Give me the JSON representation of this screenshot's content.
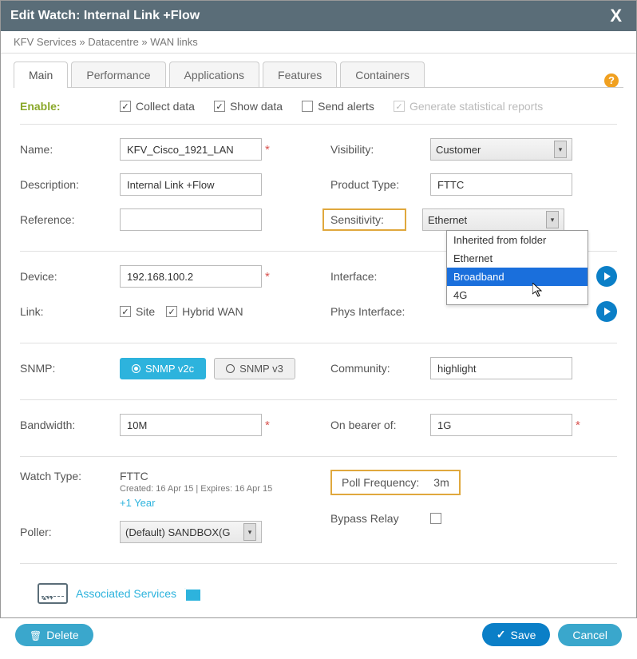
{
  "header": {
    "title": "Edit Watch: Internal Link +Flow"
  },
  "breadcrumb": [
    "KFV Services",
    "Datacentre",
    "WAN links"
  ],
  "tabs": [
    "Main",
    "Performance",
    "Applications",
    "Features",
    "Containers"
  ],
  "active_tab": "Main",
  "enable": {
    "label": "Enable:",
    "collect": {
      "label": "Collect data",
      "checked": true
    },
    "show": {
      "label": "Show data",
      "checked": true
    },
    "send": {
      "label": "Send alerts",
      "checked": false
    },
    "reports": {
      "label": "Generate statistical reports",
      "checked": true,
      "disabled": true
    }
  },
  "left1": {
    "name": {
      "label": "Name:",
      "value": "KFV_Cisco_1921_LAN",
      "required": true
    },
    "description": {
      "label": "Description:",
      "value": "Internal Link +Flow"
    },
    "reference": {
      "label": "Reference:",
      "value": ""
    }
  },
  "right1": {
    "visibility": {
      "label": "Visibility:",
      "value": "Customer"
    },
    "product_type": {
      "label": "Product Type:",
      "value": "FTTC"
    },
    "sensitivity": {
      "label": "Sensitivity:",
      "value": "Ethernet",
      "options": [
        "Inherited from folder",
        "Ethernet",
        "Broadband",
        "4G"
      ],
      "highlighted": "Broadband"
    }
  },
  "left2": {
    "device": {
      "label": "Device:",
      "value": "192.168.100.2",
      "required": true
    },
    "link": {
      "label": "Link:",
      "site": {
        "label": "Site",
        "checked": true
      },
      "hybrid": {
        "label": "Hybrid WAN",
        "checked": true
      }
    }
  },
  "right2": {
    "interface": {
      "label": "Interface:"
    },
    "phys_interface": {
      "label": "Phys Interface:"
    }
  },
  "snmp": {
    "label": "SNMP:",
    "v2c": "SNMP v2c",
    "v3": "SNMP v3",
    "selected": "v2c",
    "community": {
      "label": "Community:",
      "value": "highlight"
    }
  },
  "bandwidth": {
    "label": "Bandwidth:",
    "value": "10M",
    "required": true,
    "bearer_label": "On bearer of:",
    "bearer_value": "1G",
    "bearer_required": true
  },
  "watch_type": {
    "label": "Watch Type:",
    "value": "FTTC",
    "sub": "Created: 16 Apr 15 | Expires: 16 Apr 15",
    "extend": "+1 Year"
  },
  "poll": {
    "label": "Poll Frequency:",
    "value": "3m"
  },
  "bypass": {
    "label": "Bypass Relay",
    "checked": false
  },
  "poller": {
    "label": "Poller:",
    "value": "(Default) SANDBOX(G"
  },
  "assoc": {
    "label": "Associated Services"
  },
  "footer": {
    "delete": "Delete",
    "save": "Save",
    "cancel": "Cancel"
  }
}
